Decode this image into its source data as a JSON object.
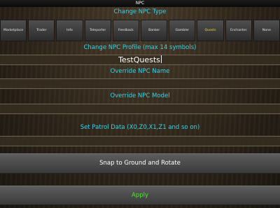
{
  "window": {
    "title": "NPC"
  },
  "npc_type": {
    "heading": "Change NPC Type",
    "options": [
      "Marketplace",
      "Trader",
      "Info",
      "Teleporter",
      "Feedback",
      "Banker",
      "Gambler",
      "Quests",
      "Enchanter",
      "None"
    ],
    "selected": "Quests"
  },
  "profile": {
    "heading": "Change NPC Profile (max 14 symbols)",
    "value": "TestQuests"
  },
  "override_name": {
    "heading": "Override NPC Name",
    "value": ""
  },
  "override_model": {
    "heading": "Override NPC Model",
    "value": ""
  },
  "patrol": {
    "heading": "Set Patrol Data (X0,Z0,X1,Z1 and so on)",
    "value": ""
  },
  "actions": {
    "snap_label": "Snap to Ground and Rotate",
    "apply_label": "Apply"
  },
  "colors": {
    "heading": "#37d4e8",
    "selected_type": "#f2d544",
    "apply_text": "#44ee22"
  }
}
